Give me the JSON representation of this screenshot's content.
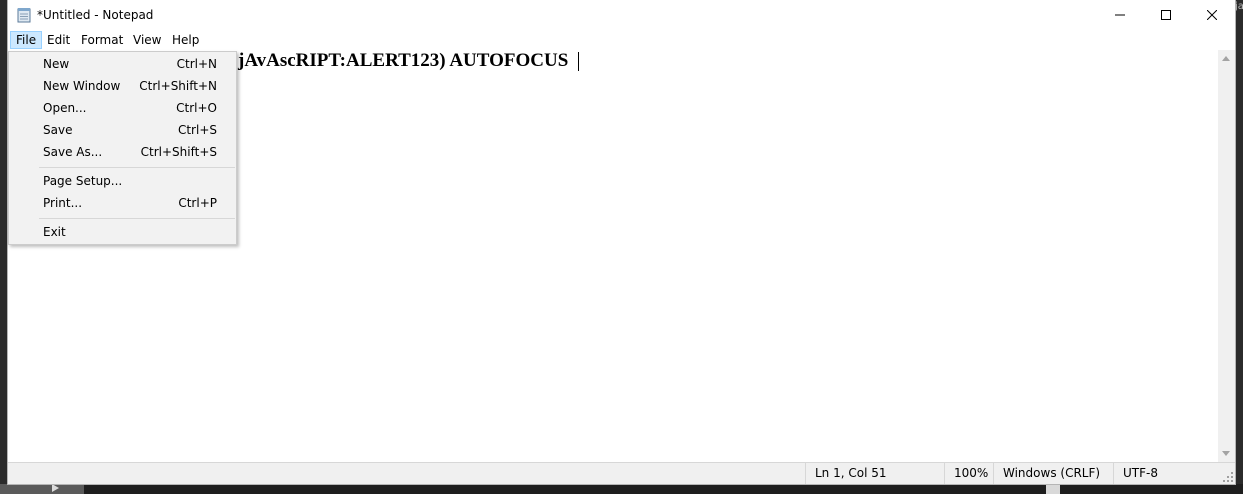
{
  "window": {
    "title": "*Untitled - Notepad",
    "minimize_symbol": "—",
    "maximize_symbol": "☐",
    "close_symbol": "✕"
  },
  "menubar": {
    "items": [
      {
        "label": "File",
        "active": true
      },
      {
        "label": "Edit"
      },
      {
        "label": "Format"
      },
      {
        "label": "View"
      },
      {
        "label": "Help"
      }
    ]
  },
  "editor": {
    "visible_text": "jAvAscRIPT:ALERT123) AUTOFOCUS"
  },
  "file_menu": {
    "items": [
      {
        "label": "New",
        "shortcut": "Ctrl+N"
      },
      {
        "label": "New Window",
        "shortcut": "Ctrl+Shift+N"
      },
      {
        "label": "Open...",
        "shortcut": "Ctrl+O"
      },
      {
        "label": "Save",
        "shortcut": "Ctrl+S"
      },
      {
        "label": "Save As...",
        "shortcut": "Ctrl+Shift+S"
      },
      {
        "label": "Page Setup...",
        "shortcut": ""
      },
      {
        "label": "Print...",
        "shortcut": "Ctrl+P"
      },
      {
        "label": "Exit",
        "shortcut": ""
      }
    ]
  },
  "statusbar": {
    "position": "Ln 1, Col 51",
    "zoom": "100%",
    "line_ending": "Windows (CRLF)",
    "encoding": "UTF-8"
  },
  "background": {
    "right_edge_text": "ja"
  },
  "colors": {
    "menu_highlight": "#cce8ff",
    "menu_highlight_border": "#99d1ff",
    "dropdown_bg": "#f2f2f2",
    "statusbar_bg": "#f0f0f0"
  }
}
